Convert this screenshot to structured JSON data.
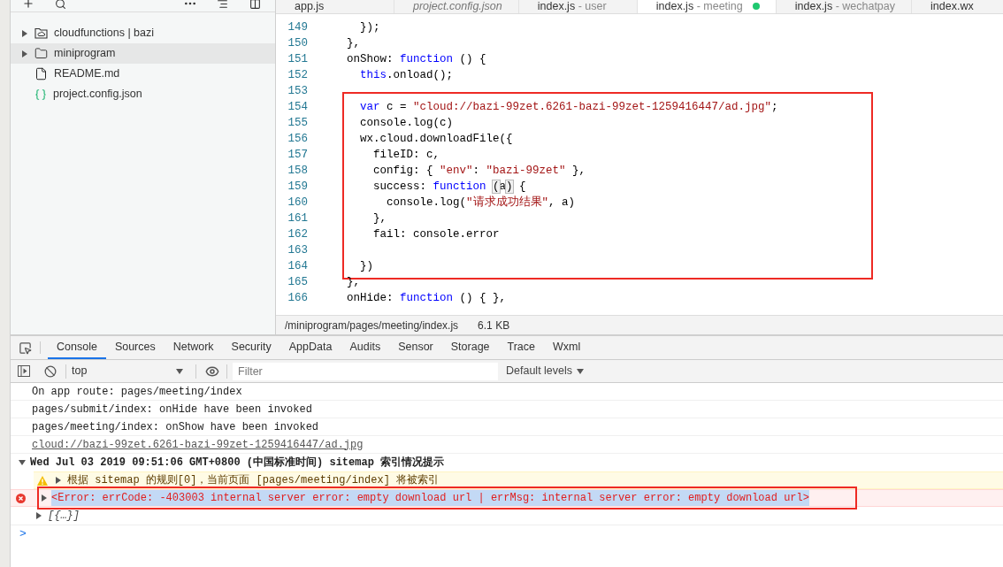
{
  "sidebar": {
    "tree": [
      {
        "name": "cloudfunctions | bazi",
        "kind": "cloud-folder",
        "expanded": false,
        "selected": false
      },
      {
        "name": "miniprogram",
        "kind": "folder",
        "expanded": false,
        "selected": true
      },
      {
        "name": "README.md",
        "kind": "file",
        "selected": false
      },
      {
        "name": "project.config.json",
        "kind": "json",
        "selected": false
      }
    ]
  },
  "editor": {
    "tabs": [
      {
        "name": "app.js",
        "preview": false,
        "selected": false,
        "modified": false
      },
      {
        "name": "project.config.json",
        "preview": true,
        "selected": false,
        "modified": false
      },
      {
        "name": "index.js",
        "suffix": "- user",
        "preview": false,
        "selected": false,
        "modified": false
      },
      {
        "name": "index.js",
        "suffix": "- meeting",
        "preview": false,
        "selected": true,
        "modified": true
      },
      {
        "name": "index.js",
        "suffix": "- wechatpay",
        "preview": false,
        "selected": false,
        "modified": false
      },
      {
        "name": "index.wx",
        "preview": false,
        "selected": false,
        "modified": false
      }
    ],
    "blocks": [
      {
        "highlighted": false,
        "lines": [
          {
            "number": "149",
            "tokens": [
              {
                "kind": "plain",
                "text": "  });"
              }
            ]
          },
          {
            "number": "150",
            "tokens": [
              {
                "kind": "plain",
                "text": "},"
              }
            ]
          },
          {
            "number": "151",
            "tokens": [
              {
                "kind": "plain",
                "text": "onShow: "
              },
              {
                "kind": "keyword",
                "text": "function"
              },
              {
                "kind": "plain",
                "text": " () {"
              }
            ]
          },
          {
            "number": "152",
            "tokens": [
              {
                "kind": "keyword",
                "text": "  this"
              },
              {
                "kind": "plain",
                "text": ".onload();"
              }
            ]
          },
          {
            "number": "153"
          }
        ]
      },
      {
        "highlighted": true,
        "lines": [
          {
            "number": "154",
            "tokens": [
              {
                "kind": "keyword",
                "text": "  var"
              },
              {
                "kind": "plain",
                "text": " c = "
              },
              {
                "kind": "string",
                "text": "\"cloud://bazi-99zet.6261-bazi-99zet-1259416447/ad.jpg\""
              },
              {
                "kind": "plain",
                "text": ";"
              }
            ]
          },
          {
            "number": "155",
            "tokens": [
              {
                "kind": "plain",
                "text": "  console.log(c)"
              }
            ]
          },
          {
            "number": "156",
            "tokens": [
              {
                "kind": "plain",
                "text": "  wx.cloud.downloadFile({"
              }
            ]
          },
          {
            "number": "157",
            "tokens": [
              {
                "kind": "plain",
                "text": "    fileID: c,"
              }
            ]
          },
          {
            "number": "158",
            "tokens": [
              {
                "kind": "plain",
                "text": "    config: { "
              },
              {
                "kind": "string",
                "text": "\"env\""
              },
              {
                "kind": "plain",
                "text": ": "
              },
              {
                "kind": "string",
                "text": "\"bazi-99zet\""
              },
              {
                "kind": "plain",
                "text": " },"
              }
            ]
          },
          {
            "number": "159",
            "tokens": [
              {
                "kind": "plain",
                "text": "    success: "
              },
              {
                "kind": "keyword",
                "text": "function "
              },
              {
                "kind": "match",
                "text": "("
              },
              {
                "kind": "plain",
                "text": "a"
              },
              {
                "kind": "match",
                "text": ")"
              },
              {
                "kind": "plain",
                "text": " {"
              }
            ]
          },
          {
            "number": "160",
            "tokens": [
              {
                "kind": "plain",
                "text": "      console.log("
              },
              {
                "kind": "string",
                "text": "\"请求成功结果\""
              },
              {
                "kind": "plain",
                "text": ", a)"
              }
            ]
          },
          {
            "number": "161",
            "tokens": [
              {
                "kind": "plain",
                "text": "    },"
              }
            ]
          },
          {
            "number": "162",
            "tokens": [
              {
                "kind": "plain",
                "text": "    fail: console.error"
              }
            ]
          },
          {
            "number": "163"
          },
          {
            "number": "164",
            "tokens": [
              {
                "kind": "plain",
                "text": "  })"
              }
            ]
          }
        ]
      },
      {
        "highlighted": false,
        "lines": [
          {
            "number": "165",
            "tokens": [
              {
                "kind": "plain",
                "text": "},"
              }
            ]
          },
          {
            "number": "166",
            "tokens": [
              {
                "kind": "plain",
                "text": "onHide: "
              },
              {
                "kind": "keyword",
                "text": "function"
              },
              {
                "kind": "plain",
                "text": " () { },"
              }
            ]
          }
        ]
      }
    ],
    "status_bar": {
      "path": "/miniprogram/pages/meeting/index.js",
      "size": "6.1 KB"
    }
  },
  "devtools": {
    "tabs": [
      {
        "label": "Console",
        "selected": true
      },
      {
        "label": "Sources",
        "selected": false
      },
      {
        "label": "Network",
        "selected": false
      },
      {
        "label": "Security",
        "selected": false
      },
      {
        "label": "AppData",
        "selected": false
      },
      {
        "label": "Audits",
        "selected": false
      },
      {
        "label": "Sensor",
        "selected": false
      },
      {
        "label": "Storage",
        "selected": false
      },
      {
        "label": "Trace",
        "selected": false
      },
      {
        "label": "Wxml",
        "selected": false
      }
    ],
    "context": "top",
    "filter": {
      "placeholder": "Filter"
    },
    "levels": "Default levels",
    "console": [
      {
        "kind": "log",
        "text": "On app route: pages/meeting/index"
      },
      {
        "kind": "log",
        "text": "pages/submit/index: onHide have been invoked"
      },
      {
        "kind": "log",
        "text": "pages/meeting/index: onShow have been invoked"
      },
      {
        "kind": "link",
        "text": "cloud://bazi-99zet.6261-bazi-99zet-1259416447/ad.jpg"
      },
      {
        "kind": "group",
        "text": "Wed Jul 03 2019 09:51:06 GMT+0800 (中国标准时间) sitemap 索引情况提示",
        "expanded": true,
        "children": [
          {
            "kind": "warning",
            "text": "根据 sitemap 的规则[0]，当前页面 [pages/meeting/index] 将被索引",
            "expanded": false,
            "highlighted": false,
            "text_selected": false
          },
          {
            "kind": "error",
            "text": "<Error: errCode: -403003 internal server error: empty download url | errMsg: internal server error: empty download url>",
            "expanded": false,
            "highlighted": true,
            "text_selected": true
          },
          {
            "kind": "object",
            "text": "[{…}]",
            "expanded": false,
            "highlighted": false,
            "text_selected": false
          }
        ]
      }
    ],
    "prompt": ">"
  }
}
